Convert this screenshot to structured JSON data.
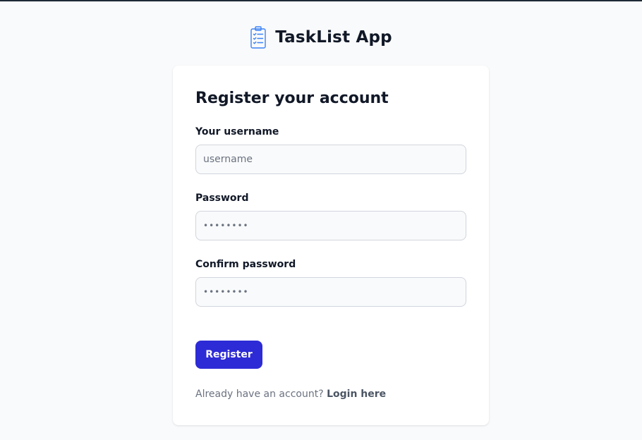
{
  "app": {
    "name": "TaskList App",
    "icon": "clipboard-list-icon"
  },
  "form": {
    "title": "Register your account",
    "fields": [
      {
        "label": "Your username",
        "placeholder": "username",
        "value": "",
        "type": "text"
      },
      {
        "label": "Password",
        "placeholder": "••••••••",
        "value": "",
        "type": "password"
      },
      {
        "label": "Confirm password",
        "placeholder": "••••••••",
        "value": "",
        "type": "password"
      }
    ],
    "submit_label": "Register",
    "login_prompt": "Already have an account?",
    "login_link": "Login here"
  },
  "colors": {
    "page_background": "#f9fafb",
    "card_background": "#ffffff",
    "primary_button": "#2d2bd6",
    "icon_accent": "#3b82f6",
    "text_primary": "#111827",
    "text_muted": "#6b7280"
  }
}
